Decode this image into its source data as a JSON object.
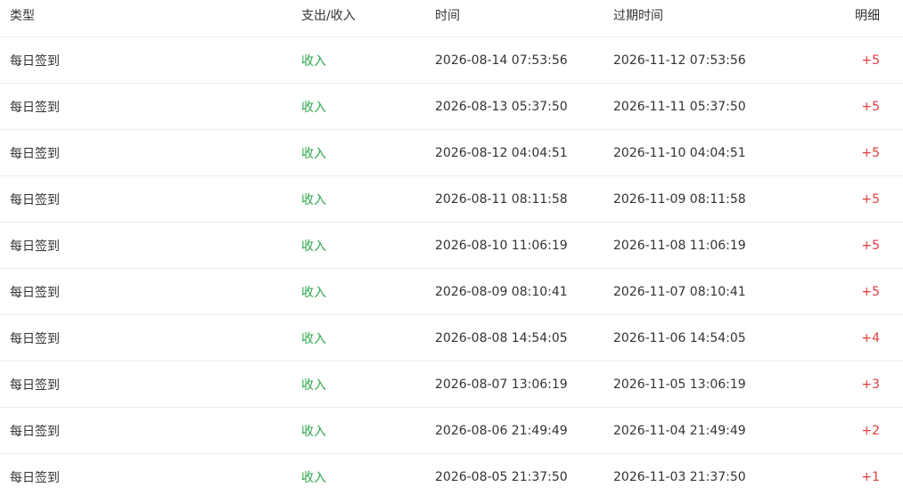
{
  "columns": {
    "type": "类型",
    "flow": "支出/收入",
    "time": "时间",
    "expire": "过期时间",
    "detail": "明细"
  },
  "colors": {
    "income": "#2da84b",
    "points_plus": "#e33b3b",
    "border": "#ececec",
    "text": "#333333"
  },
  "rows": [
    {
      "type": "每日签到",
      "flow": "收入",
      "time": "2026-08-14 07:53:56",
      "expire": "2026-11-12 07:53:56",
      "detail": "+5"
    },
    {
      "type": "每日签到",
      "flow": "收入",
      "time": "2026-08-13 05:37:50",
      "expire": "2026-11-11 05:37:50",
      "detail": "+5"
    },
    {
      "type": "每日签到",
      "flow": "收入",
      "time": "2026-08-12 04:04:51",
      "expire": "2026-11-10 04:04:51",
      "detail": "+5"
    },
    {
      "type": "每日签到",
      "flow": "收入",
      "time": "2026-08-11 08:11:58",
      "expire": "2026-11-09 08:11:58",
      "detail": "+5"
    },
    {
      "type": "每日签到",
      "flow": "收入",
      "time": "2026-08-10 11:06:19",
      "expire": "2026-11-08 11:06:19",
      "detail": "+5"
    },
    {
      "type": "每日签到",
      "flow": "收入",
      "time": "2026-08-09 08:10:41",
      "expire": "2026-11-07 08:10:41",
      "detail": "+5"
    },
    {
      "type": "每日签到",
      "flow": "收入",
      "time": "2026-08-08 14:54:05",
      "expire": "2026-11-06 14:54:05",
      "detail": "+4"
    },
    {
      "type": "每日签到",
      "flow": "收入",
      "time": "2026-08-07 13:06:19",
      "expire": "2026-11-05 13:06:19",
      "detail": "+3"
    },
    {
      "type": "每日签到",
      "flow": "收入",
      "time": "2026-08-06 21:49:49",
      "expire": "2026-11-04 21:49:49",
      "detail": "+2"
    },
    {
      "type": "每日签到",
      "flow": "收入",
      "time": "2026-08-05 21:37:50",
      "expire": "2026-11-03 21:37:50",
      "detail": "+1"
    }
  ]
}
